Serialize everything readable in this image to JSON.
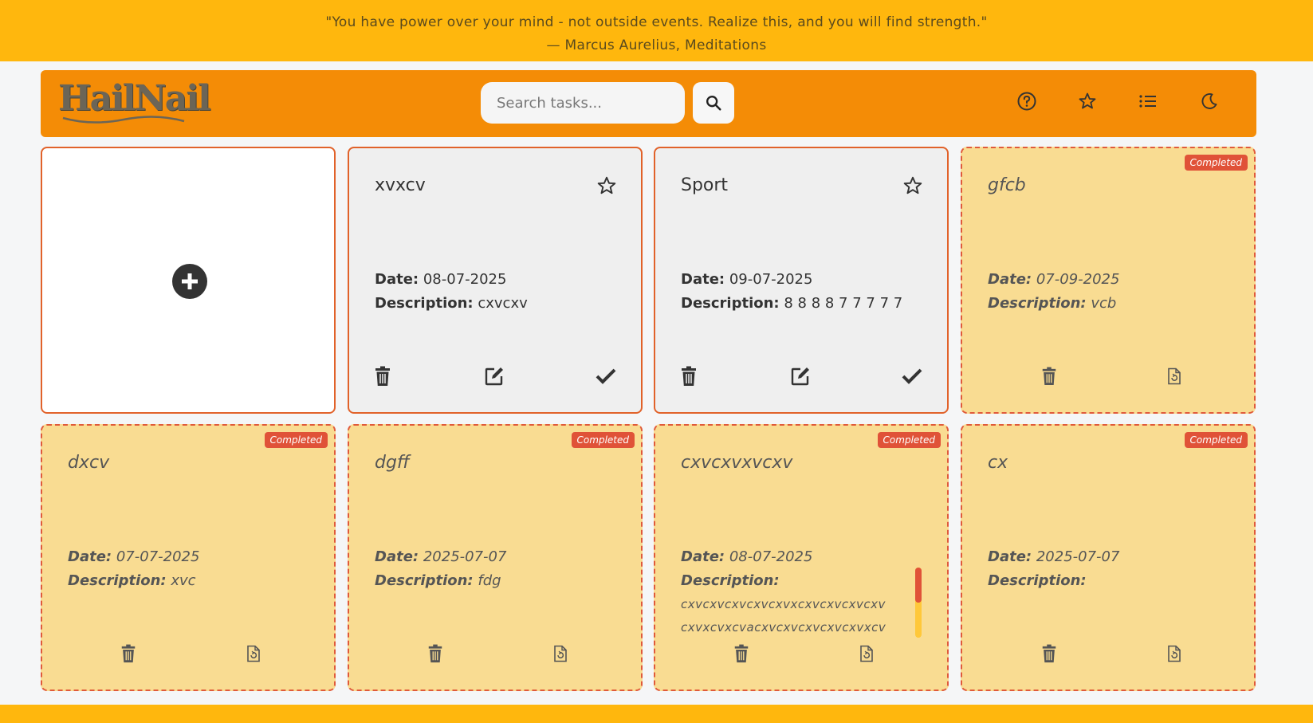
{
  "quote": {
    "text": "\"You have power over your mind - not outside events. Realize this, and you will find strength.\"",
    "author": "— Marcus Aurelius, Meditations"
  },
  "header": {
    "logo": "HailNail",
    "search_placeholder": "Search tasks...",
    "icons": [
      "help-icon",
      "star-icon",
      "list-icon",
      "moon-icon"
    ]
  },
  "labels": {
    "date": "Date:",
    "description": "Description:",
    "completed": "Completed"
  },
  "cards": [
    {
      "title": "xvxcv",
      "date": "08-07-2025",
      "description": "cxvcxv",
      "completed": false
    },
    {
      "title": "Sport",
      "date": "09-07-2025",
      "description": "8 8 8 8 7 7 7 7 7",
      "completed": false
    },
    {
      "title": "gfcb",
      "date": "07-09-2025",
      "description": "vcb",
      "completed": true
    },
    {
      "title": "dxcv",
      "date": "07-07-2025",
      "description": "xvc",
      "completed": true
    },
    {
      "title": "dgff",
      "date": "2025-07-07",
      "description": "fdg",
      "completed": true
    },
    {
      "title": "cxvcxvxvcxv",
      "date": "08-07-2025",
      "description_line1": "cxvcxvcxvcxvcxvxcxvcxvcxvcxv",
      "description_line2": "cxvxcvxcvacxvcxvcxvcxvcxvxcv",
      "completed": true
    },
    {
      "title": "cx",
      "date": "2025-07-07",
      "description": "",
      "completed": true
    }
  ],
  "colors": {
    "quote_bar": "#ffb70d",
    "header": "#f48c06",
    "card_border": "#e1622a",
    "completed_bg": "#f9dc92",
    "badge": "#e05238"
  }
}
